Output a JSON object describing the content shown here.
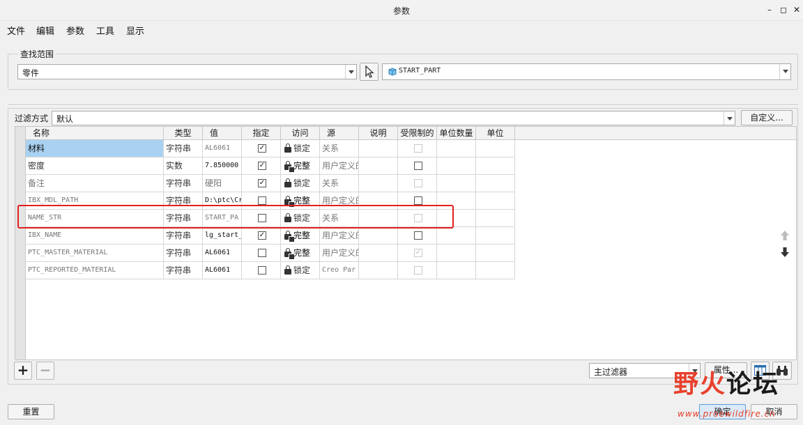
{
  "window": {
    "title": "参数",
    "minimize_glyph": "–",
    "restore_glyph": "◻",
    "close_glyph": "✕"
  },
  "menu": [
    "文件",
    "编辑",
    "参数",
    "工具",
    "显示"
  ],
  "search_scope": {
    "label": "查找范围",
    "type_value": "零件",
    "model_value": "START_PART"
  },
  "filter": {
    "label": "过滤方式",
    "value": "默认",
    "customize_label": "自定义..."
  },
  "table": {
    "columns": [
      "名称",
      "类型",
      "值",
      "指定",
      "访问",
      "源",
      "说明",
      "受限制的",
      "单位数量",
      "单位"
    ],
    "rows": [
      {
        "name": "材料",
        "type": "字符串",
        "value": "AL6061",
        "designated": true,
        "access": "锁定",
        "access_icon": "lock-icon",
        "source": "关系",
        "restricted": "disabled"
      },
      {
        "name": "密度",
        "type": "实数",
        "value": "7.850000",
        "designated": true,
        "access": "完整",
        "access_icon": "unlock-icon",
        "source": "用户定义的",
        "restricted": "empty"
      },
      {
        "name": "备注",
        "type": "字符串",
        "value": "硬阳",
        "designated": true,
        "access": "锁定",
        "access_icon": "lock-icon",
        "source": "关系",
        "restricted": "disabled"
      },
      {
        "name": "IBX_MDL_PATH",
        "type": "字符串",
        "value": "D:\\ptc\\Cr",
        "designated": false,
        "access": "完整",
        "access_icon": "unlock-icon",
        "source": "用户定义的",
        "restricted": "empty"
      },
      {
        "name": "NAME_STR",
        "type": "字符串",
        "value": "START_PA",
        "designated": false,
        "access": "锁定",
        "access_icon": "lock-icon",
        "source": "关系",
        "restricted": "disabled"
      },
      {
        "name": "IBX_NAME",
        "type": "字符串",
        "value": "lg_start_",
        "designated": true,
        "access": "完整",
        "access_icon": "unlock-icon",
        "source": "用户定义的",
        "restricted": "empty"
      },
      {
        "name": "PTC_MASTER_MATERIAL",
        "type": "字符串",
        "value": "AL6061",
        "designated": false,
        "access": "完整",
        "access_icon": "unlock-icon",
        "source": "用户定义的",
        "restricted": "disabled-checked"
      },
      {
        "name": "PTC_REPORTED_MATERIAL",
        "type": "字符串",
        "value": "AL6061",
        "designated": false,
        "access": "锁定",
        "access_icon": "lock-icon",
        "source": "Creo Par",
        "restricted": "disabled"
      }
    ]
  },
  "bottom_bar": {
    "add_glyph": "+",
    "remove_glyph": "−",
    "main_filter_value": "主过滤器",
    "properties_label": "属性...",
    "reset_label": "重置",
    "ok_label": "确定",
    "cancel_label": "取消"
  },
  "watermark": {
    "logo_red": "野火",
    "logo_dark": "论坛",
    "url": "www.proewildfire.cn"
  },
  "colors": {
    "selection": "#a9d2f2",
    "highlight": "#e02020",
    "watermark": "#e8402c"
  }
}
